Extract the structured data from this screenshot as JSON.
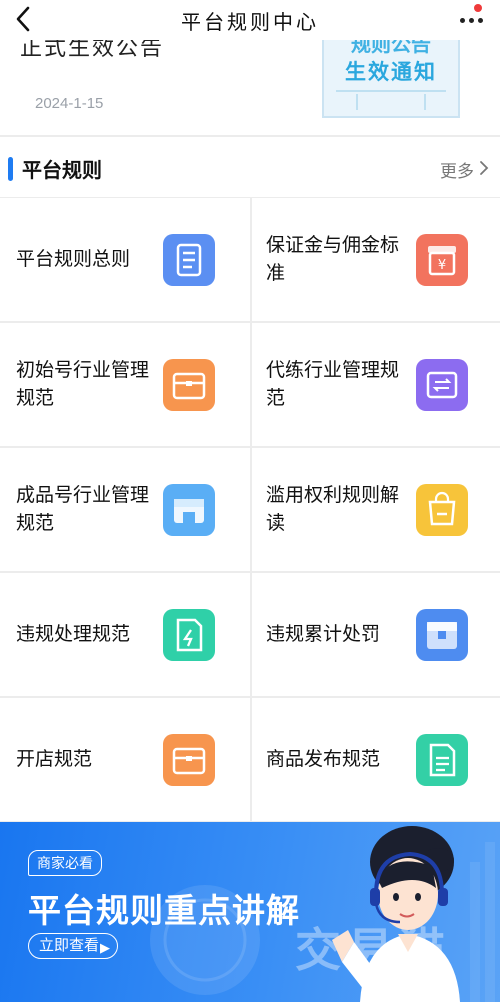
{
  "header": {
    "title": "平台规则中心"
  },
  "notice": {
    "clipped_title": "正式生效公告",
    "date": "2024-1-15",
    "thumb_line1": "规则公告",
    "thumb_line2": "生效通知"
  },
  "section": {
    "title": "平台规则",
    "more": "更多"
  },
  "rules": [
    {
      "label": "平台规则总则",
      "icon": "document-icon",
      "color": "#5b8ff2"
    },
    {
      "label": "保证金与佣金标准",
      "icon": "yen-box-icon",
      "color": "#f2735e"
    },
    {
      "label": "初始号行业管理规范",
      "icon": "briefcase-icon",
      "color": "#f7954e"
    },
    {
      "label": "代练行业管理规范",
      "icon": "exchange-icon",
      "color": "#8c6cf0"
    },
    {
      "label": "成品号行业管理规范",
      "icon": "storefront-icon",
      "color": "#5aaef5"
    },
    {
      "label": "滥用权利规则解读",
      "icon": "shopping-bag-icon",
      "color": "#f7c43a"
    },
    {
      "label": "违规处理规范",
      "icon": "lightning-doc-icon",
      "color": "#2fd0a8"
    },
    {
      "label": "违规累计处罚",
      "icon": "package-icon",
      "color": "#4e8cf0"
    },
    {
      "label": "开店规范",
      "icon": "briefcase-icon",
      "color": "#f7954e"
    },
    {
      "label": "商品发布规范",
      "icon": "list-doc-icon",
      "color": "#33d0a6"
    }
  ],
  "banner": {
    "tag": "商家必看",
    "title": "平台规则重点讲解",
    "button": "立即查看",
    "watermark": "交易猫"
  }
}
